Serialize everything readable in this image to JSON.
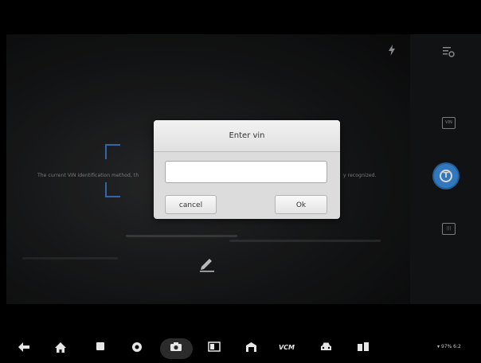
{
  "camera": {
    "hint_text": "The current VIN identification method, th",
    "hint_text_right": "y recognized."
  },
  "dialog": {
    "title": "Enter vin",
    "input_value": "",
    "input_placeholder": "",
    "cancel_label": "cancel",
    "ok_label": "Ok"
  },
  "right_panel": {
    "icons": [
      "settings-list-icon",
      "vin-scan-mode-icon",
      "text-mode-icon",
      "barcode-mode-icon"
    ]
  },
  "navbar": {
    "icons": [
      "back-icon",
      "home-icon",
      "recent-apps-icon",
      "browser-icon",
      "camera-icon",
      "display-icon",
      "garage-icon",
      "vcm-icon",
      "vehicle-icon",
      "shop-icon"
    ],
    "vcm_label": "VCM",
    "status_text": "97% 6:2"
  },
  "colors": {
    "accent": "#3a8ee0",
    "scan_corner": "#3b78c9",
    "dialog_bg": "#dcdcdc"
  }
}
